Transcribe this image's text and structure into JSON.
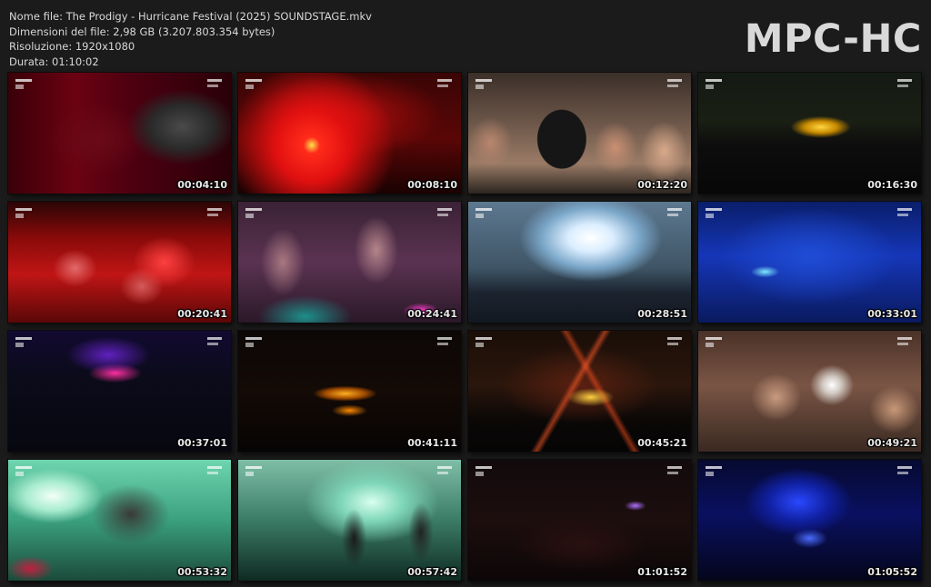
{
  "file_info": {
    "name": "Nome file: The Prodigy - Hurricane Festival (2025) SOUNDSTAGE.mkv",
    "size": "Dimensioni del file: 2,98 GB (3.207.803.354 bytes)",
    "resolution": "Risoluzione: 1920x1080",
    "duration": "Durata: 01:10:02"
  },
  "brand": "MPC-HC",
  "thumbnails": [
    {
      "time": "00:04:10",
      "scene": "performer-red"
    },
    {
      "time": "00:08:10",
      "scene": "red-stage"
    },
    {
      "time": "00:12:20",
      "scene": "crowd-closeup"
    },
    {
      "time": "00:16:30",
      "scene": "distant-stage-dark"
    },
    {
      "time": "00:20:41",
      "scene": "red-crowd"
    },
    {
      "time": "00:24:41",
      "scene": "purple-hands"
    },
    {
      "time": "00:28:51",
      "scene": "white-light-crowd"
    },
    {
      "time": "00:33:01",
      "scene": "blue-stage"
    },
    {
      "time": "00:37:01",
      "scene": "dark-stage-purple"
    },
    {
      "time": "00:41:11",
      "scene": "orange-stage-dark"
    },
    {
      "time": "00:45:21",
      "scene": "laser-stage"
    },
    {
      "time": "00:49:21",
      "scene": "crowd-fans"
    },
    {
      "time": "00:53:32",
      "scene": "green-band"
    },
    {
      "time": "00:57:42",
      "scene": "guitarist-fog"
    },
    {
      "time": "01:01:52",
      "scene": "dark-crowd"
    },
    {
      "time": "01:05:52",
      "scene": "blue-stage-dark"
    }
  ]
}
